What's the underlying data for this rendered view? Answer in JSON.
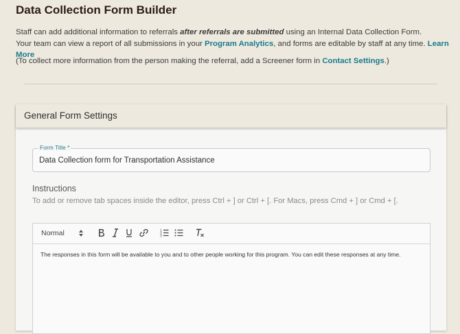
{
  "page": {
    "title": "Data Collection Form Builder",
    "intro_line1_part1": "Staff can add additional information to referrals ",
    "intro_line1_em": "after referrals are submitted",
    "intro_line1_part2": " using an Internal Data Collection Form.",
    "intro_line2_part1": "Your team can view a report of all submissions in your ",
    "program_analytics_link": "Program Analytics",
    "intro_line2_part2": ", and forms are editable by staff at any time. ",
    "learn_more_link": "Learn More",
    "note_part1": "(To collect more information from the person making the referral, add a Screener form in ",
    "contact_settings_link": "Contact Settings",
    "note_part2": ".)"
  },
  "card": {
    "header": "General Form Settings",
    "form_title_label": "Form Title *",
    "form_title_value": "Data Collection form for Transportation Assistance",
    "instructions_heading": "Instructions",
    "instructions_help": "To add or remove tab spaces inside the editor, press Ctrl + ] or Ctrl + [. For Macs, press Cmd + ] or Cmd + [."
  },
  "editor": {
    "format_select": "Normal",
    "toolbar_icons": [
      "bold-icon",
      "italic-icon",
      "underline-icon",
      "link-icon",
      "ordered-list-icon",
      "bullet-list-icon",
      "clear-format-icon"
    ],
    "content": "The responses in this form will be available to you and to other people working for this program. You can edit these responses at any time."
  },
  "colors": {
    "background": "#ede9de",
    "link": "#1a7a8c",
    "title": "#2b1b17"
  }
}
